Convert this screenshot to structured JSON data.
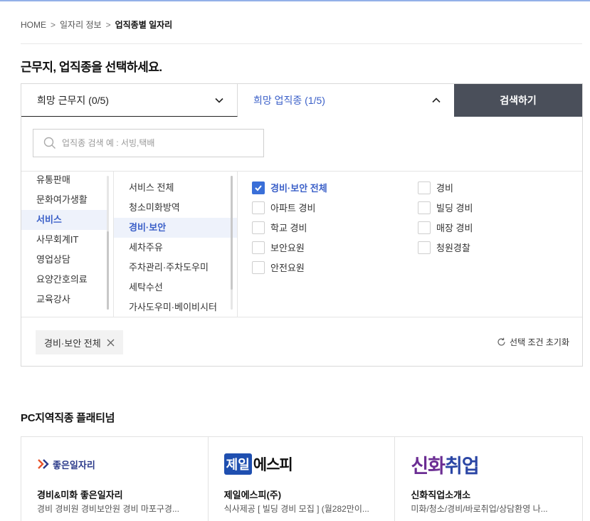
{
  "breadcrumb": {
    "home": "HOME",
    "level1": "일자리 정보",
    "current": "업직종별 일자리",
    "sep": ">"
  },
  "heading": "근무지, 업직종을 선택하세요.",
  "tabs": {
    "region": "희망 근무지 (0/5)",
    "job": "희망 업직종 (1/5)",
    "search_button": "검색하기"
  },
  "search": {
    "placeholder": "업직종 검색 예 : 서빙,택배"
  },
  "categories": [
    {
      "label": "유통판매",
      "selected": false
    },
    {
      "label": "문화여가생활",
      "selected": false
    },
    {
      "label": "서비스",
      "selected": true
    },
    {
      "label": "사무회계IT",
      "selected": false
    },
    {
      "label": "영업상담",
      "selected": false
    },
    {
      "label": "요양간호의료",
      "selected": false
    },
    {
      "label": "교육강사",
      "selected": false
    }
  ],
  "subcategories": [
    {
      "label": "서비스 전체",
      "selected": false
    },
    {
      "label": "청소미화방역",
      "selected": false
    },
    {
      "label": "경비·보안",
      "selected": true
    },
    {
      "label": "세차주유",
      "selected": false
    },
    {
      "label": "주차관리·주차도우미",
      "selected": false
    },
    {
      "label": "세탁수선",
      "selected": false
    },
    {
      "label": "가사도우미·베이비시터",
      "selected": false
    }
  ],
  "options_left": [
    {
      "label": "경비·보안 전체",
      "checked": true
    },
    {
      "label": "아파트 경비",
      "checked": false
    },
    {
      "label": "학교 경비",
      "checked": false
    },
    {
      "label": "보안요원",
      "checked": false
    },
    {
      "label": "안전요원",
      "checked": false
    }
  ],
  "options_right": [
    {
      "label": "경비",
      "checked": false
    },
    {
      "label": "빌딩 경비",
      "checked": false
    },
    {
      "label": "매장 경비",
      "checked": false
    },
    {
      "label": "청원경찰",
      "checked": false
    }
  ],
  "selected_chip": "경비·보안 전체",
  "reset_label": "선택 조건 초기화",
  "section_title": "PC지역직종 플래티넘",
  "cards": [
    {
      "logo_text": "좋은일자리",
      "name": "경비&미화 좋은일자리",
      "desc": "경비 경비원 경비보안원 경비 마포구경..."
    },
    {
      "logo_box": "제일",
      "logo_text": "에스피",
      "name": "제일에스피(주)",
      "desc": "식사제공 [ 빌딩 경비 모집 ] (월282만이..."
    },
    {
      "logo_t1": "신화",
      "logo_t2": "취업",
      "name": "신화직업소개소",
      "desc": "미화/청소/경비/바로취업/상담환영 나..."
    }
  ],
  "colors": {
    "accent": "#3a5fc8",
    "search_button_bg": "#4a4f5a",
    "checkbox_on": "#3a6fd8"
  }
}
